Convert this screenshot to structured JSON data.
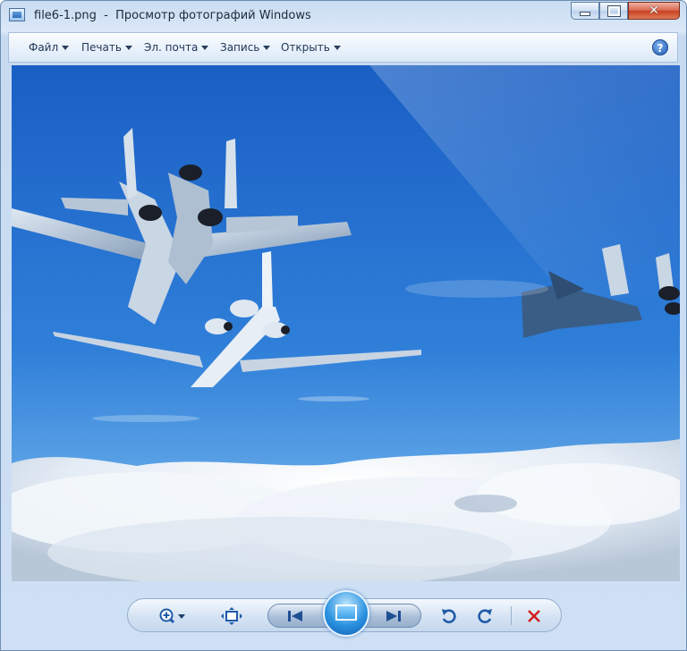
{
  "window": {
    "title": "file6-1.png  -  Просмотр фотографий Windows",
    "controls": {
      "minimize": "minimize",
      "maximize": "maximize",
      "close": "close"
    }
  },
  "menu": {
    "items": [
      {
        "label": "Файл",
        "has_dropdown": true
      },
      {
        "label": "Печать",
        "has_dropdown": true
      },
      {
        "label": "Эл. почта",
        "has_dropdown": true
      },
      {
        "label": "Запись",
        "has_dropdown": true
      },
      {
        "label": "Открыть",
        "has_dropdown": true
      }
    ],
    "help_label": "?"
  },
  "photo": {
    "file_name": "file6-1.png"
  },
  "toolbar": {
    "buttons": [
      "zoom-icon",
      "actual-size-icon",
      "previous-icon",
      "slideshow-icon",
      "next-icon",
      "rotate-ccw-icon",
      "rotate-cw-icon",
      "delete-icon"
    ]
  },
  "colors": {
    "accent": "#2c93e0",
    "delete": "#d21f1f",
    "frame": "#cfe0f4"
  }
}
